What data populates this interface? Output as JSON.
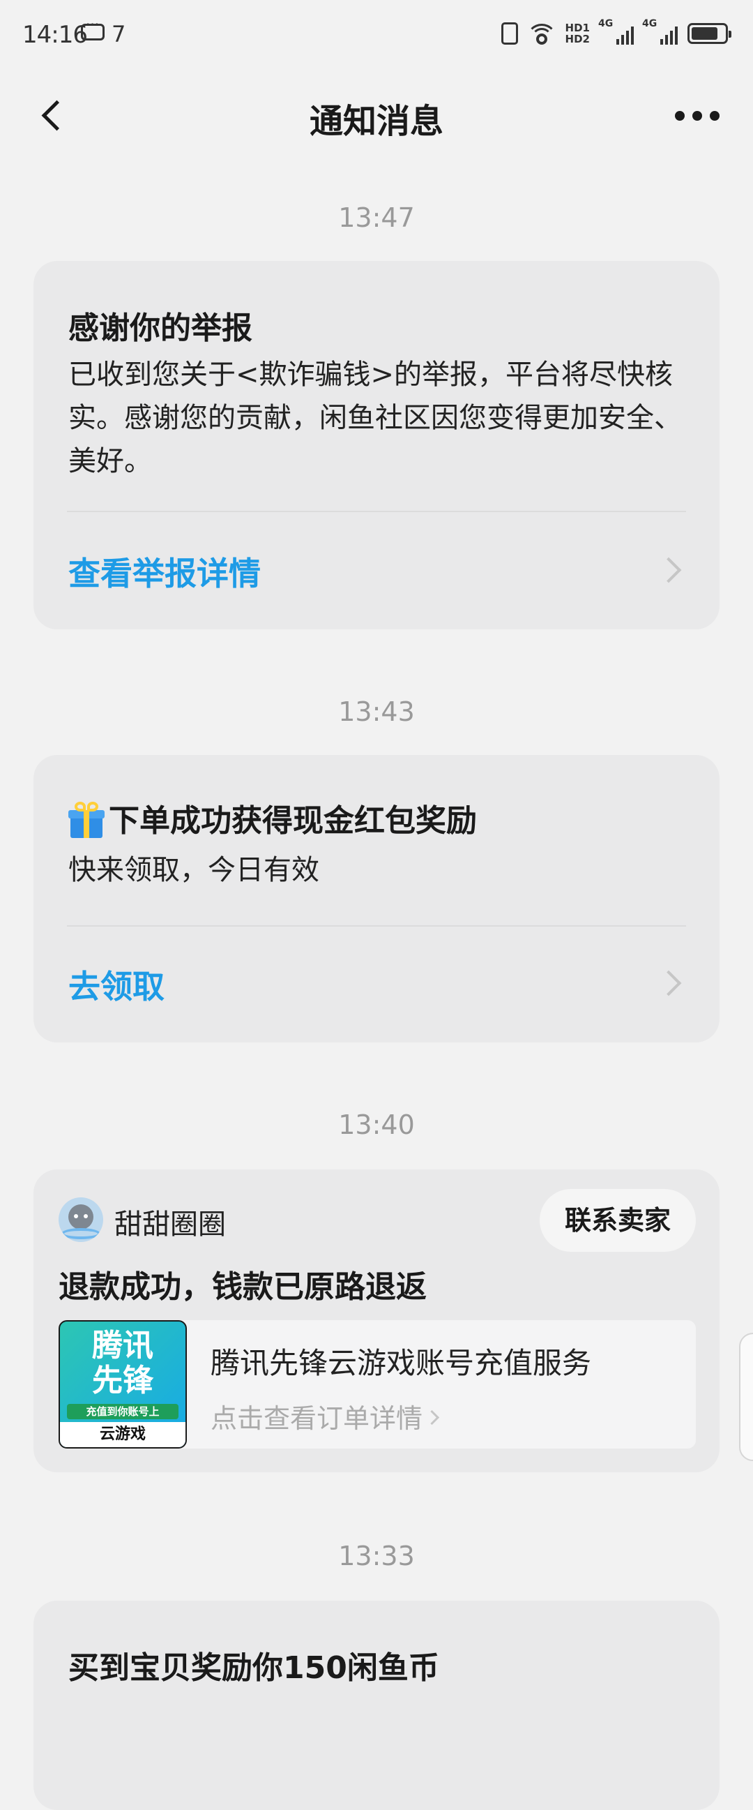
{
  "status_bar": {
    "time": "14:16",
    "notif_count": "7",
    "hd1": "HD1",
    "hd2": "HD2",
    "net1": "4G",
    "net2": "4G",
    "battery_level": 0.8
  },
  "nav": {
    "title": "通知消息"
  },
  "messages": [
    {
      "time": "13:47",
      "title": "感谢你的举报",
      "body": "已收到您关于<欺诈骗钱>的举报，平台将尽快核实。感谢您的贡献，闲鱼社区因您变得更加安全、美好。",
      "action": "查看举报详情"
    },
    {
      "time": "13:43",
      "title": "下单成功获得现金红包奖励",
      "icon": "gift-icon",
      "body": "快来领取，今日有效",
      "action": "去领取"
    },
    {
      "time": "13:40",
      "seller": "甜甜圈圈",
      "contact": "联系卖家",
      "title": "退款成功，钱款已原路退返",
      "thumb_text": "腾讯先锋",
      "thumb_band": "充值到你账号上",
      "thumb_foot": "云游戏",
      "product": "腾讯先锋云游戏账号充值服务",
      "product_link": "点击查看订单详情"
    },
    {
      "time": "13:33",
      "title": "买到宝贝奖励你150闲鱼币"
    }
  ]
}
